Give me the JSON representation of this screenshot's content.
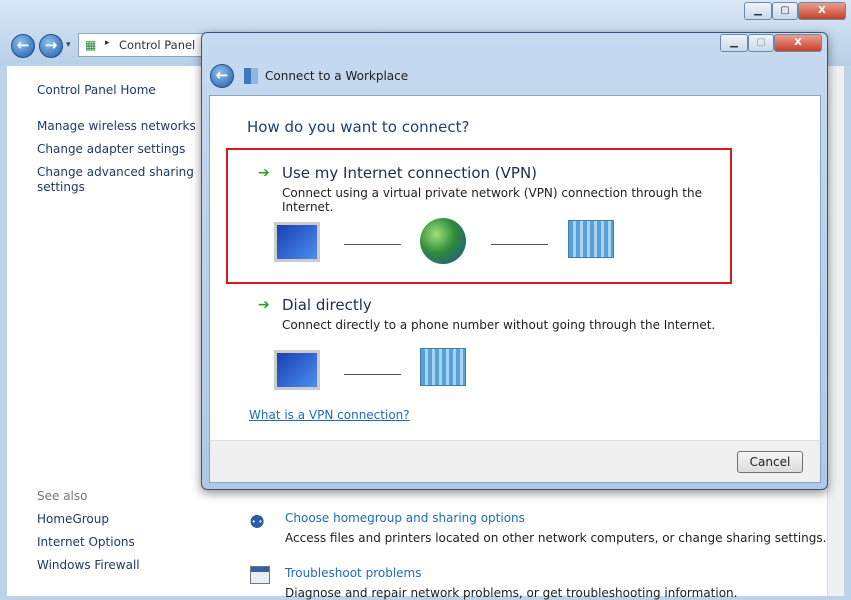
{
  "main_window": {
    "breadcrumb": "Control Panel"
  },
  "sidebar": {
    "items": [
      "Control Panel Home",
      "Manage wireless networks",
      "Change adapter settings",
      "Change advanced sharing settings"
    ],
    "see_also_label": "See also",
    "see_also": [
      "HomeGroup",
      "Internet Options",
      "Windows Firewall"
    ]
  },
  "main": {
    "tasks": [
      {
        "title": "Choose homegroup and sharing options",
        "desc": "Access files and printers located on other network computers, or change sharing settings."
      },
      {
        "title": "Troubleshoot problems",
        "desc": "Diagnose and repair network problems, or get troubleshooting information."
      }
    ]
  },
  "dialog": {
    "title": "Connect to a Workplace",
    "heading": "How do you want to connect?",
    "options": [
      {
        "title": "Use my Internet connection (VPN)",
        "desc": "Connect using a virtual private network (VPN) connection through the Internet.",
        "selected": true
      },
      {
        "title": "Dial directly",
        "desc": "Connect directly to a phone number without going through the Internet.",
        "selected": false
      }
    ],
    "help_link": "What is a VPN connection?",
    "cancel": "Cancel"
  },
  "colors": {
    "highlight": "#e0161e",
    "link": "#1e6bb8",
    "heading": "#1e3f7a"
  }
}
